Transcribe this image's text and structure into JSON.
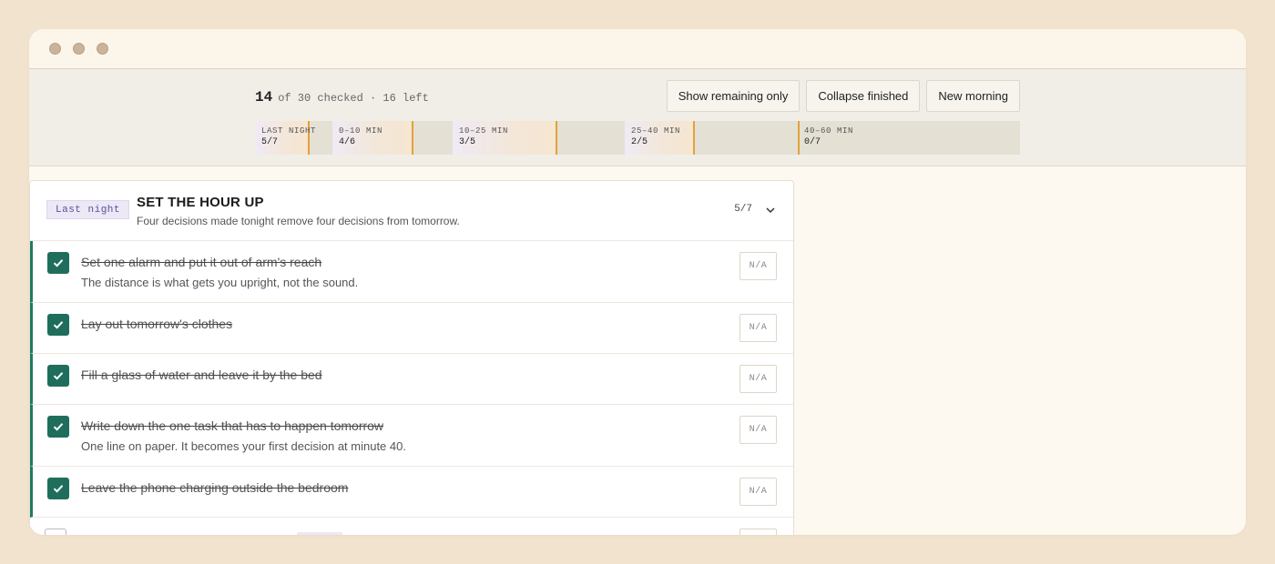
{
  "summary": {
    "checked": "14",
    "rest": "of 30 checked · 16 left"
  },
  "actions": {
    "show_remaining": "Show remaining only",
    "collapse_finished": "Collapse finished",
    "new_morning": "New morning"
  },
  "progress": [
    {
      "label": "LAST NIGHT",
      "value": "5/7",
      "fraction": 0.714
    },
    {
      "label": "0–10 MIN",
      "value": "4/6",
      "fraction": 0.667
    },
    {
      "label": "10–25 MIN",
      "value": "3/5",
      "fraction": 0.6
    },
    {
      "label": "25–40 MIN",
      "value": "2/5",
      "fraction": 0.4
    },
    {
      "label": "40–60 MIN",
      "value": "0/7",
      "fraction": 0.0
    }
  ],
  "section": {
    "tag": "Last night",
    "title": "SET THE HOUR UP",
    "subtitle": "Four decisions made tonight remove four decisions from tomorrow.",
    "count": "5/7"
  },
  "items": [
    {
      "text": "Set one alarm and put it out of arm's reach",
      "note": "The distance is what gets you upright, not the sound.",
      "na": "N/A"
    },
    {
      "text": "Lay out tomorrow's clothes",
      "note": "",
      "na": "N/A"
    },
    {
      "text": "Fill a glass of water and leave it by the bed",
      "note": "",
      "na": "N/A"
    },
    {
      "text": "Write down the one task that has to happen tomorrow",
      "note": "One line on paper. It becomes your first decision at minute 40.",
      "na": "N/A"
    },
    {
      "text": "Leave the phone charging outside the bedroom",
      "note": "",
      "na": "N/A"
    }
  ],
  "colors": {
    "accent": "#1f6e5c",
    "progress_marker": "#e2a23a",
    "tag_bg": "#ece8f6"
  }
}
